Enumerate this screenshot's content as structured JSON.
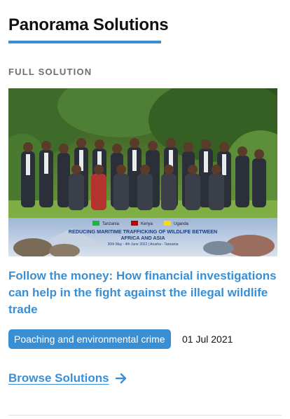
{
  "section": {
    "title": "Panorama Solutions",
    "kicker": "FULL SOLUTION"
  },
  "card": {
    "image_alt": "Group photo of workshop participants in front of a banner",
    "banner_countries": [
      "Tanzania",
      "Kenya",
      "Uganda"
    ],
    "banner_title_line1": "REDUCING MARITIME TRAFFICKING OF WILDLIFE BETWEEN",
    "banner_title_line2": "AFRICA AND ASIA",
    "banner_dates": "30th May - 4th June 2022 | Arusha - Tanzania",
    "headline": "Follow the money: How financial investigations can help in the fight against the illegal wildlife trade",
    "tag": "Poaching and environmental crime",
    "date": "01 Jul 2021"
  },
  "browse": {
    "label": "Browse Solutions",
    "icon": "arrow-right-icon"
  },
  "colors": {
    "accent": "#3a8fd4",
    "title": "#111111",
    "kicker": "#6e6e6e"
  }
}
